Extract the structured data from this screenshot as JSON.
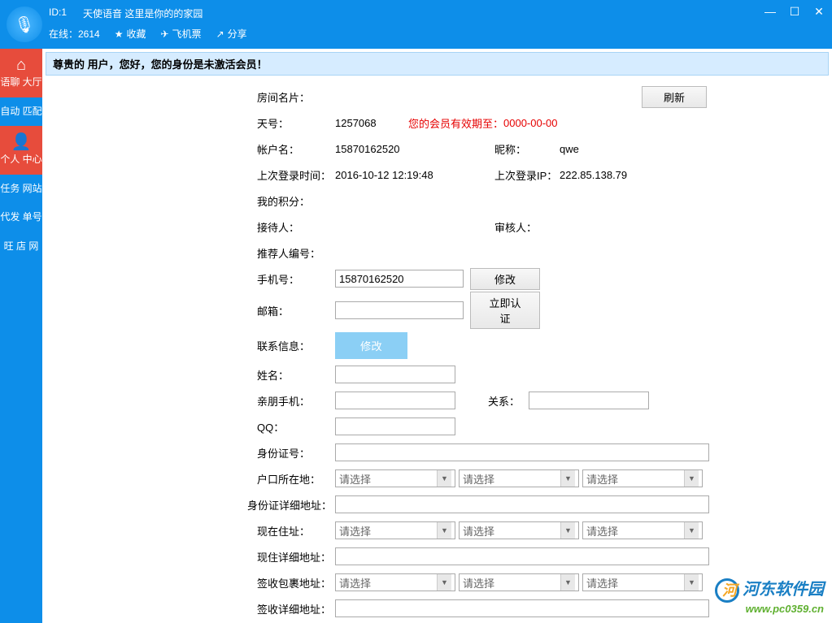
{
  "titlebar": {
    "id_label": "ID:1",
    "app_title": "天使语音   这里是你的的家园",
    "online_label": "在线：2614",
    "fav": "收藏",
    "ticket": "飞机票",
    "share": "分享"
  },
  "sidebar": {
    "lobby": "语聊\n大厅",
    "auto": "自动\n匹配",
    "personal": "个人\n中心",
    "task": "任务\n网站",
    "dispatch": "代发\n单号",
    "shop": "旺\n店\n网"
  },
  "notice": "尊贵的  用户，您好，您的身份是未激活会员！",
  "form": {
    "room_card": "房间名片：",
    "refresh": "刷新",
    "tian_label": "天号：",
    "tian_value": "1257068",
    "expire_prefix": "您的会员有效期至：",
    "expire_value": "0000-00-00",
    "account_label": "帐户名：",
    "account_value": "15870162520",
    "nick_label": "昵称：",
    "nick_value": "qwe",
    "last_login_time_label": "上次登录时间：",
    "last_login_time_value": "2016-10-12 12:19:48",
    "last_login_ip_label": "上次登录IP：",
    "last_login_ip_value": "222.85.138.79",
    "points_label": "我的积分：",
    "receiver_label": "接待人：",
    "auditor_label": "审核人：",
    "referrer_label": "推荐人编号：",
    "phone_label": "手机号：",
    "phone_value": "15870162520",
    "modify": "修改",
    "email_label": "邮箱：",
    "verify_now": "立即认证",
    "contact_label": "联系信息：",
    "name_label": "姓名：",
    "relative_phone_label": "亲朋手机：",
    "relation_label": "关系：",
    "qq_label": "QQ：",
    "idcard_label": "身份证号：",
    "hukou_label": "户口所在地：",
    "idcard_addr_label": "身份证详细地址：",
    "current_addr_label": "现在住址：",
    "current_addr_detail_label": "现住详细地址：",
    "package_addr_label": "签收包裹地址：",
    "package_addr_detail_label": "签收详细地址：",
    "select_placeholder": "请选择"
  },
  "watermark": {
    "text": "河东软件园",
    "url": "www.pc0359.cn"
  }
}
